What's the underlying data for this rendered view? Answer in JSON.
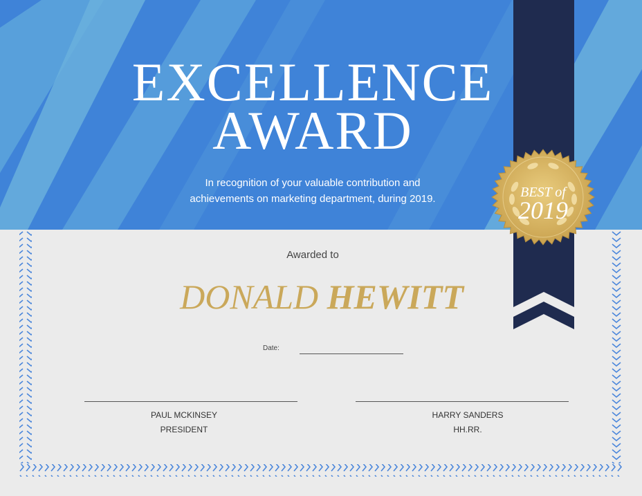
{
  "certificate": {
    "title_line1": "EXCELLENCE",
    "title_line2": "AWARD",
    "subtitle_line1": "In recognition of your valuable contribution and",
    "subtitle_line2": "achievements on marketing department, during  2019.",
    "awarded_to": "Awarded to",
    "recipient_first": "DONALD",
    "recipient_last": "HEWITT",
    "date_label": "Date:",
    "seal_line1": "BEST of",
    "seal_line2": "2019"
  },
  "signatories": [
    {
      "name": "PAUL MCKINSEY",
      "title": "PRESIDENT"
    },
    {
      "name": "HARRY SANDERS",
      "title": "HH.RR."
    }
  ],
  "colors": {
    "banner_blue": "#3f83d8",
    "stripe_light": "#6ab0dd",
    "navy": "#1f2b4f",
    "gold": "#caa85a",
    "background": "#ebebeb"
  }
}
